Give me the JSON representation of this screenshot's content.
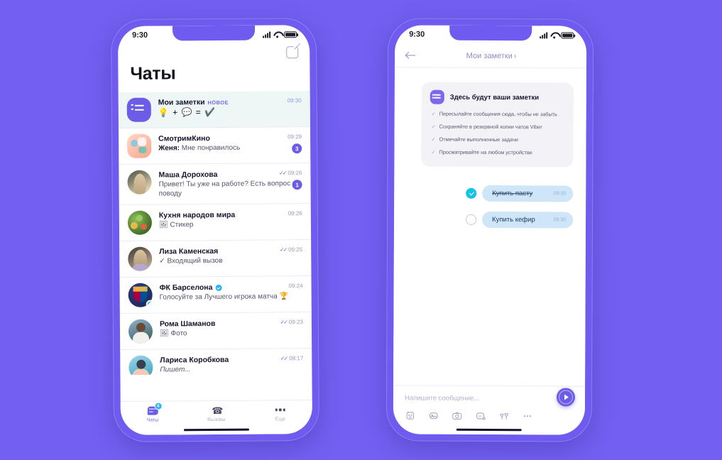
{
  "theme": {
    "background": "#7360f2",
    "frame": "#6f5bef",
    "accent": "#6c5ce7",
    "accent_light": "#7b68ee",
    "verified_blue": "#29b6f6",
    "task_bubble": "#cfe5f8",
    "highlight_row": "#eef6f6"
  },
  "status_bar": {
    "time": "9:30"
  },
  "left_phone": {
    "header": {
      "title": "Чаты",
      "compose_icon": "compose-icon"
    },
    "chats": [
      {
        "name": "Мои заметки",
        "badge": "НОВОЕ",
        "message": "💡 + 💬 = ✔️",
        "message_is_emoji": true,
        "time": "09:30",
        "time_style": "blue",
        "unread": "",
        "ticks": "",
        "highlight": true,
        "avatar": "notes-icon"
      },
      {
        "name": "СмотримКино",
        "badge": "",
        "sender": "Женя:",
        "message": "Мне понравилось",
        "time": "09:29",
        "time_style": "grey",
        "unread": "3",
        "ticks": "",
        "highlight": false,
        "avatar": "movie-avatar"
      },
      {
        "name": "Маша Дорохова",
        "badge": "",
        "message": "Привет! Ты уже на работе? Есть вопрос по поводу",
        "time": "09:26",
        "time_style": "grey",
        "unread": "1",
        "ticks": "✓✓",
        "highlight": false,
        "avatar": "masha-avatar"
      },
      {
        "name": "Кухня народов мира",
        "badge": "",
        "message": "🖼 Стикер",
        "time": "09:26",
        "time_style": "grey",
        "unread": "",
        "ticks": "",
        "highlight": false,
        "avatar": "food-avatar"
      },
      {
        "name": "Лиза Каменская",
        "badge": "",
        "message": "✓ Входящий вызов",
        "time": "09:25",
        "time_style": "grey",
        "unread": "",
        "ticks": "✓✓",
        "highlight": false,
        "avatar": "liza-avatar"
      },
      {
        "name": "ФК Барселона",
        "badge": "",
        "verified": true,
        "message": "Голосуйте за Лучшего игрока матча 🏆",
        "time": "09:24",
        "time_style": "grey",
        "unread": "",
        "ticks": "",
        "highlight": false,
        "avatar": "barcelona-avatar",
        "bot": true
      },
      {
        "name": "Рома Шаманов",
        "badge": "",
        "message": "🖼 Фото",
        "time": "09:23",
        "time_style": "grey",
        "unread": "",
        "ticks": "✓✓",
        "highlight": false,
        "avatar": "roma-avatar"
      },
      {
        "name": "Лариса Коробкова",
        "badge": "",
        "message": "Пишет...",
        "italic": true,
        "time": "08:17",
        "time_style": "grey",
        "unread": "",
        "ticks": "✓✓",
        "highlight": false,
        "avatar": "larisa-avatar"
      }
    ],
    "tabbar": [
      {
        "label": "Чаты",
        "icon": "chats-icon",
        "count": "4",
        "active": true
      },
      {
        "label": "Вызовы",
        "icon": "phone-icon",
        "count": "",
        "active": false
      },
      {
        "label": "Ещё",
        "icon": "more-icon",
        "count": "",
        "active": false
      }
    ]
  },
  "right_phone": {
    "header": {
      "back_icon": "back-arrow-icon",
      "title": "Мои заметки",
      "chevron": "›"
    },
    "info_card": {
      "icon": "notes-icon",
      "title": "Здесь будут ваши заметки",
      "items": [
        "Пересылайте сообщения сюда, чтобы не забыть",
        "Сохраняйте в резервной копии чатов Viber",
        "Отмечайте выполненные задачи",
        "Просматривайте на любом устройстве"
      ]
    },
    "tasks": [
      {
        "text": "Купить пасту",
        "time": "09:30",
        "done": true
      },
      {
        "text": "Купить кефир",
        "time": "09:30",
        "done": false
      }
    ],
    "composer": {
      "placeholder": "Напишите сообщение...",
      "icons": [
        "sticker-icon",
        "image-icon",
        "camera-icon",
        "gif-icon",
        "hearts-icon",
        "more-icon"
      ],
      "send_icon": "send-icon"
    }
  }
}
